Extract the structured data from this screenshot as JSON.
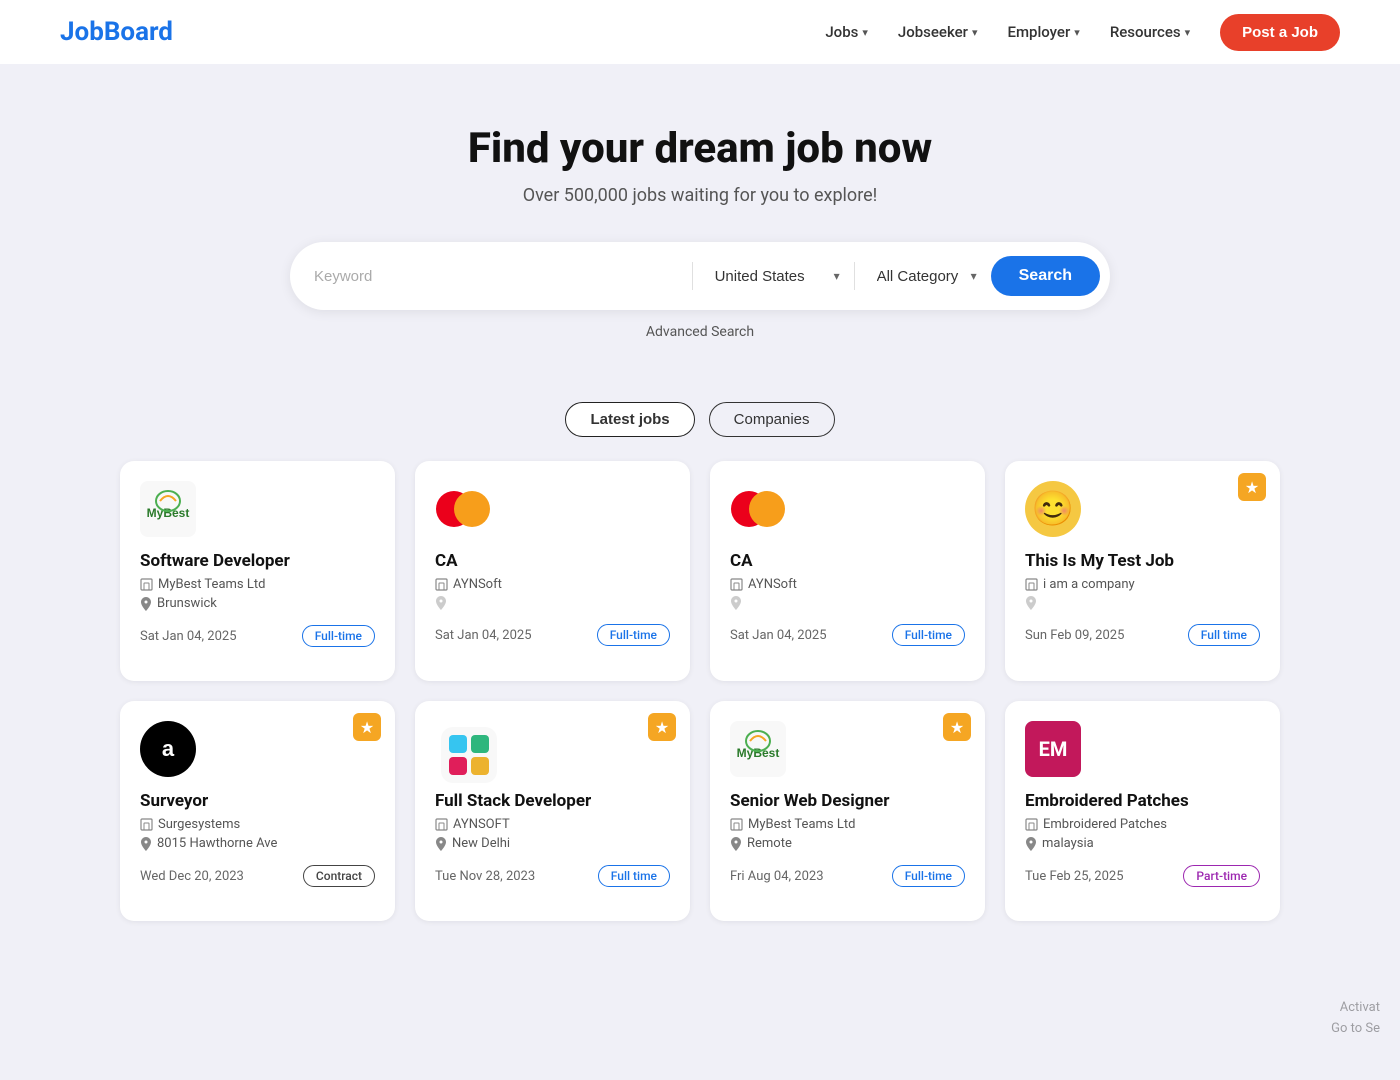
{
  "nav": {
    "logo": "JobBoard",
    "links": [
      {
        "label": "Jobs",
        "has_dropdown": true
      },
      {
        "label": "Jobseeker",
        "has_dropdown": true
      },
      {
        "label": "Employer",
        "has_dropdown": true
      },
      {
        "label": "Resources",
        "has_dropdown": true
      }
    ],
    "post_job_label": "Post a Job"
  },
  "hero": {
    "title": "Find your dream job now",
    "subtitle": "Over 500,000 jobs waiting for you to explore!"
  },
  "search": {
    "keyword_placeholder": "Keyword",
    "location_value": "United States",
    "category_value": "All Category",
    "search_label": "Search",
    "advanced_search_label": "Advanced Search"
  },
  "tabs": [
    {
      "label": "Latest jobs",
      "active": true
    },
    {
      "label": "Companies",
      "active": false
    }
  ],
  "jobs": [
    {
      "id": 1,
      "title": "Software Developer",
      "company": "MyBest Teams Ltd",
      "location": "Brunswick",
      "date": "Sat Jan 04, 2025",
      "type": "Full-time",
      "type_class": "full-time",
      "featured": false,
      "logo_type": "mybest"
    },
    {
      "id": 2,
      "title": "CA",
      "company": "AYNSoft",
      "location": "",
      "date": "Sat Jan 04, 2025",
      "type": "Full-time",
      "type_class": "full-time",
      "featured": false,
      "logo_type": "mastercard"
    },
    {
      "id": 3,
      "title": "CA",
      "company": "AYNSoft",
      "location": "",
      "date": "Sat Jan 04, 2025",
      "type": "Full-time",
      "type_class": "full-time",
      "featured": false,
      "logo_type": "mastercard"
    },
    {
      "id": 4,
      "title": "This Is My Test Job",
      "company": "i am a company",
      "location": "",
      "date": "Sun Feb 09, 2025",
      "type": "Full time",
      "type_class": "full-time",
      "featured": true,
      "logo_type": "smiley"
    },
    {
      "id": 5,
      "title": "Surveyor",
      "company": "Surgesystems",
      "location": "8015 Hawthorne Ave",
      "date": "Wed Dec 20, 2023",
      "type": "Contract",
      "type_class": "contract",
      "featured": true,
      "logo_type": "amazon"
    },
    {
      "id": 6,
      "title": "Full Stack Developer",
      "company": "AYNSOFT",
      "location": "New Delhi",
      "date": "Tue Nov 28, 2023",
      "type": "Full time",
      "type_class": "full-time",
      "featured": true,
      "logo_type": "slack"
    },
    {
      "id": 7,
      "title": "Senior Web Designer",
      "company": "MyBest Teams Ltd",
      "location": "Remote",
      "date": "Fri Aug 04, 2023",
      "type": "Full-time",
      "type_class": "full-time",
      "featured": true,
      "logo_type": "mybest"
    },
    {
      "id": 8,
      "title": "Embroidered Patches",
      "company": "Embroidered Patches",
      "location": "malaysia",
      "date": "Tue Feb 25, 2025",
      "type": "Part-time",
      "type_class": "part-time",
      "featured": false,
      "logo_type": "em"
    }
  ],
  "watermark": {
    "line1": "Activat",
    "line2": "Go to Se"
  }
}
